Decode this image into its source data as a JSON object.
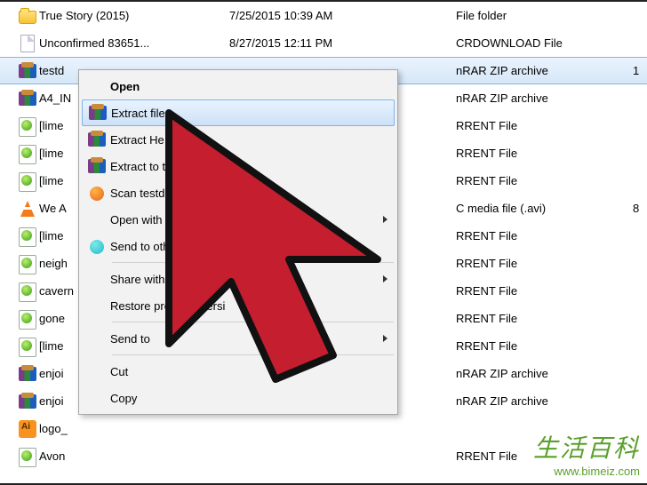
{
  "files": [
    {
      "icon": "folder",
      "name": "True Story (2015)",
      "date": "7/25/2015 10:39 AM",
      "type": "File folder",
      "extra": ""
    },
    {
      "icon": "file",
      "name": "Unconfirmed 83651...",
      "date": "8/27/2015 12:11 PM",
      "type": "CRDOWNLOAD File",
      "extra": ""
    },
    {
      "icon": "rar",
      "name": "testd",
      "date": "",
      "type": "nRAR ZIP archive",
      "extra": "1",
      "selected": true
    },
    {
      "icon": "rar",
      "name": "A4_IN",
      "date": "",
      "type": "nRAR ZIP archive",
      "extra": ""
    },
    {
      "icon": "torrent",
      "name": "[lime",
      "date": "",
      "type": "RRENT File",
      "extra": ""
    },
    {
      "icon": "torrent",
      "name": "[lime",
      "date": "",
      "type": "RRENT File",
      "extra": ""
    },
    {
      "icon": "torrent",
      "name": "[lime",
      "date": "",
      "type": "RRENT File",
      "extra": ""
    },
    {
      "icon": "vlc",
      "name": "We A",
      "date": "",
      "type": "C media file (.avi)",
      "extra": "8"
    },
    {
      "icon": "torrent",
      "name": "[lime",
      "date": "",
      "type": "RRENT File",
      "extra": ""
    },
    {
      "icon": "torrent",
      "name": "neigh",
      "date": "",
      "type": "RRENT File",
      "extra": ""
    },
    {
      "icon": "torrent",
      "name": "cavern",
      "date": "",
      "type": "RRENT File",
      "extra": ""
    },
    {
      "icon": "torrent",
      "name": "gone",
      "date": "",
      "type": "RRENT File",
      "extra": ""
    },
    {
      "icon": "torrent",
      "name": "[lime",
      "date": "",
      "type": "RRENT File",
      "extra": ""
    },
    {
      "icon": "rar",
      "name": "enjoi",
      "date": "",
      "type": "nRAR ZIP archive",
      "extra": ""
    },
    {
      "icon": "rar",
      "name": "enjoi",
      "date": "",
      "type": "nRAR ZIP archive",
      "extra": ""
    },
    {
      "icon": "ai",
      "name": "logo_",
      "date": "",
      "type": "",
      "extra": ""
    },
    {
      "icon": "torrent",
      "name": "Avon",
      "date": "",
      "type": "RRENT File",
      "extra": ""
    }
  ],
  "menu": {
    "open": "Open",
    "extract_files": "Extract files...",
    "extract_here": "Extract He",
    "extract_to": "Extract to te",
    "scan": "Scan testdisk-",
    "open_with": "Open with",
    "send_other": "Send to other dev",
    "share_with": "Share with",
    "restore": "Restore previous versi",
    "send_to": "Send to",
    "cut": "Cut",
    "copy": "Copy"
  },
  "watermark": {
    "cn": "生活百科",
    "url": "www.bimeiz.com"
  },
  "cursor_color": "#c41e2f",
  "cursor_stroke": "#111111"
}
